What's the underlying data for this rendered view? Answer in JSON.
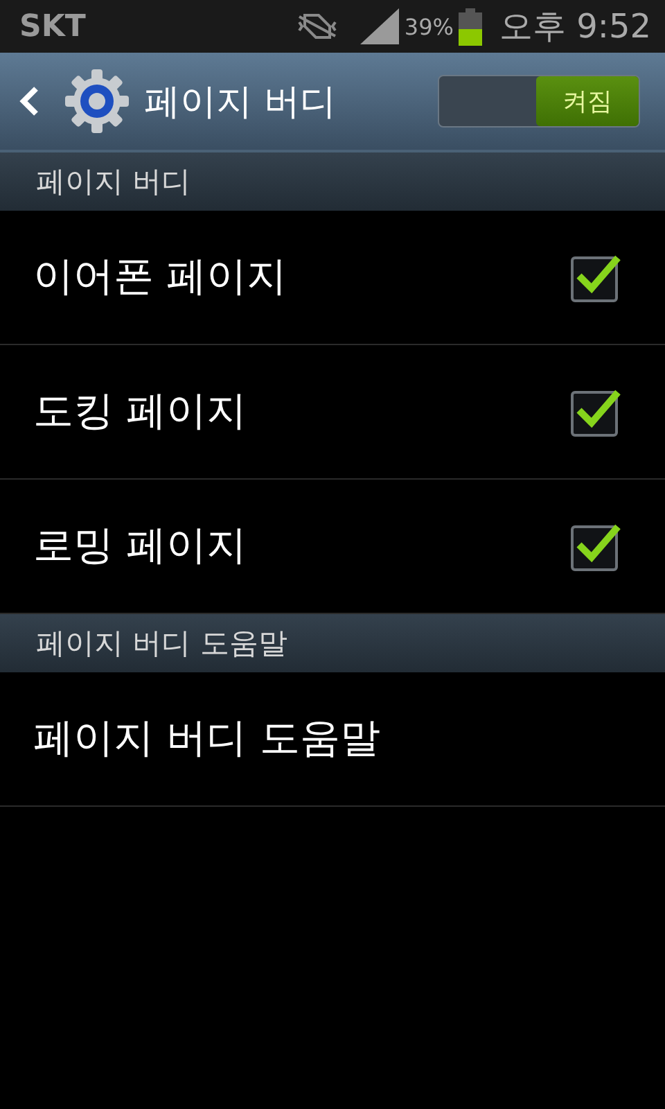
{
  "status_bar": {
    "carrier": "SKT",
    "battery_percent": "39%",
    "time": "오후 9:52"
  },
  "header": {
    "title": "페이지 버디",
    "switch": {
      "label": "켜짐",
      "on": true
    }
  },
  "sections": [
    {
      "title": "페이지 버디",
      "items": [
        {
          "label": "이어폰 페이지",
          "kind": "checkbox",
          "checked": true
        },
        {
          "label": "도킹 페이지",
          "kind": "checkbox",
          "checked": true
        },
        {
          "label": "로밍 페이지",
          "kind": "checkbox",
          "checked": true
        }
      ]
    },
    {
      "title": "페이지 버디 도움말",
      "items": [
        {
          "label": "페이지 버디 도움말",
          "kind": "plain"
        }
      ]
    }
  ]
}
